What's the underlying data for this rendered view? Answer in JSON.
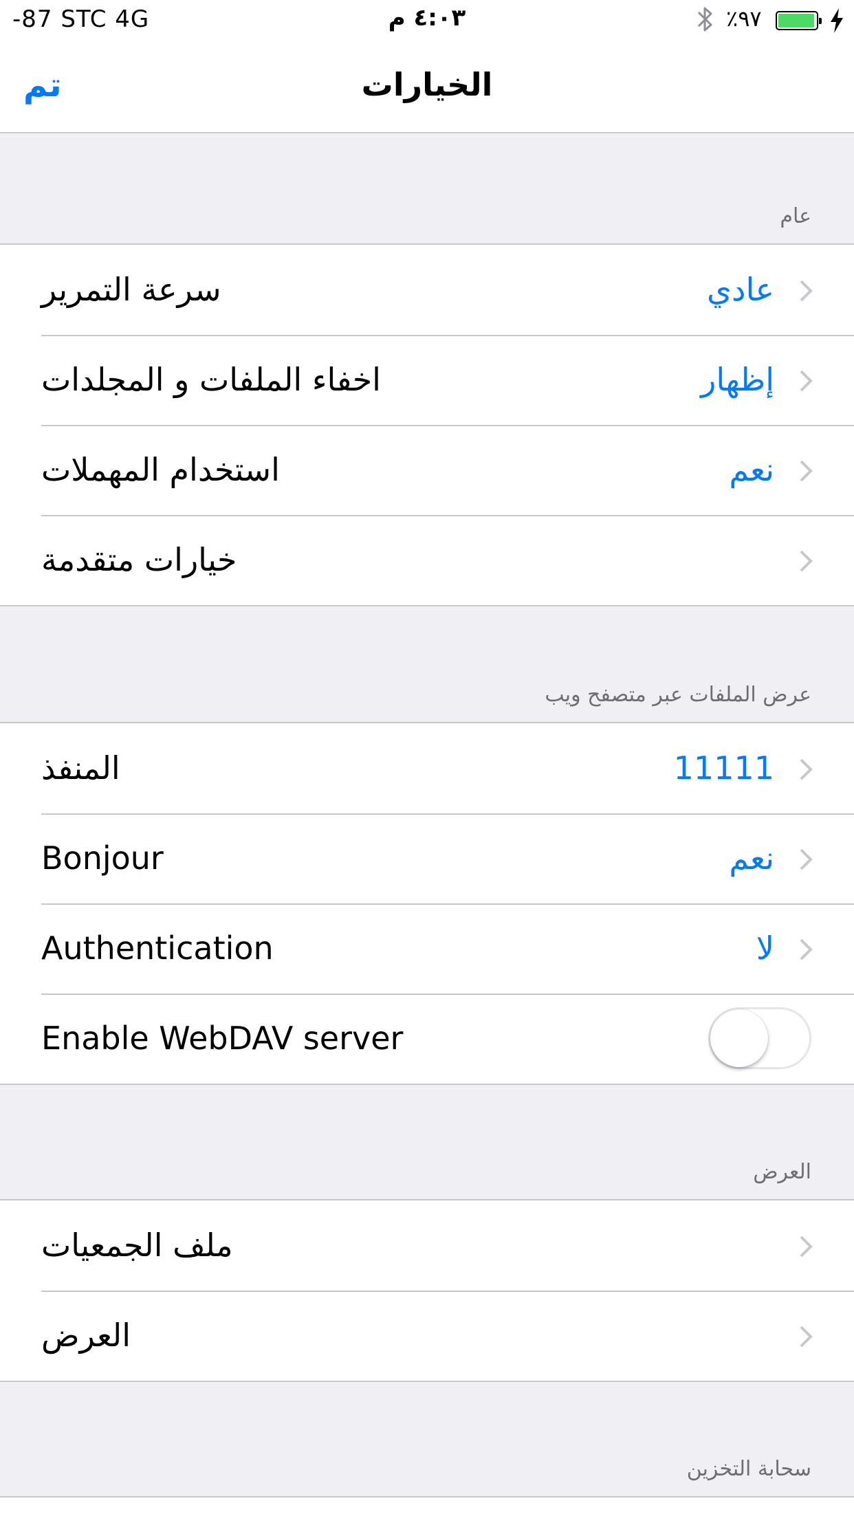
{
  "status_bar": {
    "carrier": "-87 STC   4G",
    "time": "٤:٠٣ م",
    "battery_percent": "٪٩٧",
    "battery_level": 0.97,
    "battery_color": "#4cd964"
  },
  "nav": {
    "done_label": "تم",
    "title": "الخيارات"
  },
  "accent_color": "#007aff",
  "sections": {
    "general": {
      "header": "عام",
      "rows": [
        {
          "label": "سرعة التمرير",
          "value": "عادي"
        },
        {
          "label": "اخفاء الملفات و المجلدات",
          "value": "إظهار"
        },
        {
          "label": "استخدام المهملات",
          "value": "نعم"
        },
        {
          "label": "خيارات متقدمة",
          "value": ""
        }
      ]
    },
    "web": {
      "header": "عرض الملفات عبر متصفح ويب",
      "rows": [
        {
          "label": "المنفذ",
          "value": "11111"
        },
        {
          "label": "Bonjour",
          "value": "نعم"
        },
        {
          "label": "Authentication",
          "value": "لا"
        },
        {
          "label": "Enable WebDAV server",
          "toggle_on": false
        }
      ]
    },
    "display": {
      "header": "العرض",
      "rows": [
        {
          "label": "ملف الجمعيات",
          "value": ""
        },
        {
          "label": "العرض",
          "value": ""
        }
      ]
    },
    "cloud": {
      "header": "سحابة التخزين"
    }
  }
}
